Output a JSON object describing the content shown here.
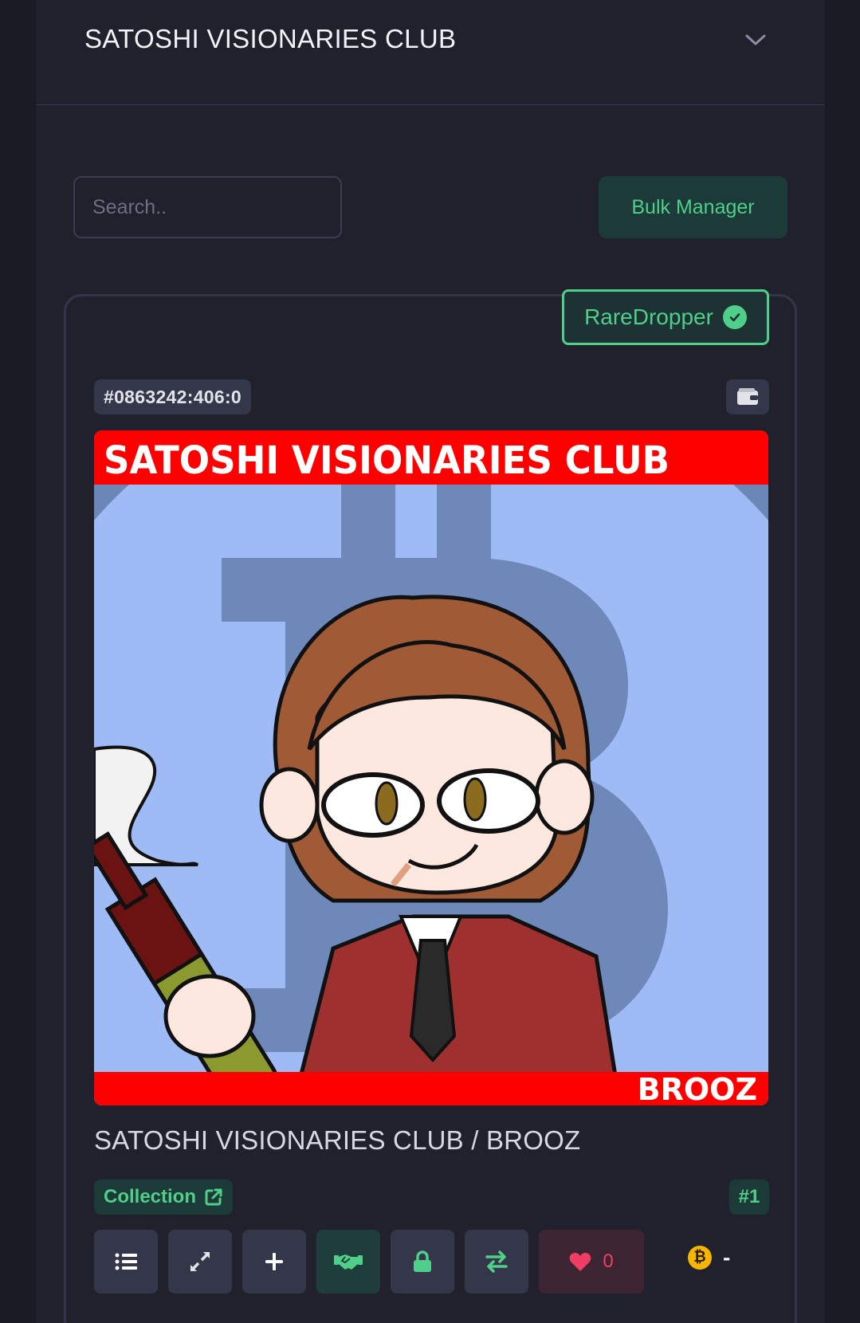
{
  "header": {
    "title": "SATOSHI VISIONARIES CLUB"
  },
  "toolbar": {
    "search_placeholder": "Search..",
    "bulk_label": "Bulk Manager"
  },
  "card": {
    "badge": "RareDropper",
    "inscription_id": "#0863242:406:0",
    "artwork": {
      "top_banner": "SATOSHI VISIONARIES CLUB",
      "bottom_banner": "BROOZ"
    },
    "title": "SATOSHI VISIONARIES CLUB / BROOZ",
    "collection_label": "Collection",
    "rank": "#1",
    "likes": "0",
    "price": "-"
  },
  "colors": {
    "accent": "#4fcf8a",
    "like": "#ef3e63",
    "btc": "#f7b500",
    "banner": "#ff0000"
  }
}
